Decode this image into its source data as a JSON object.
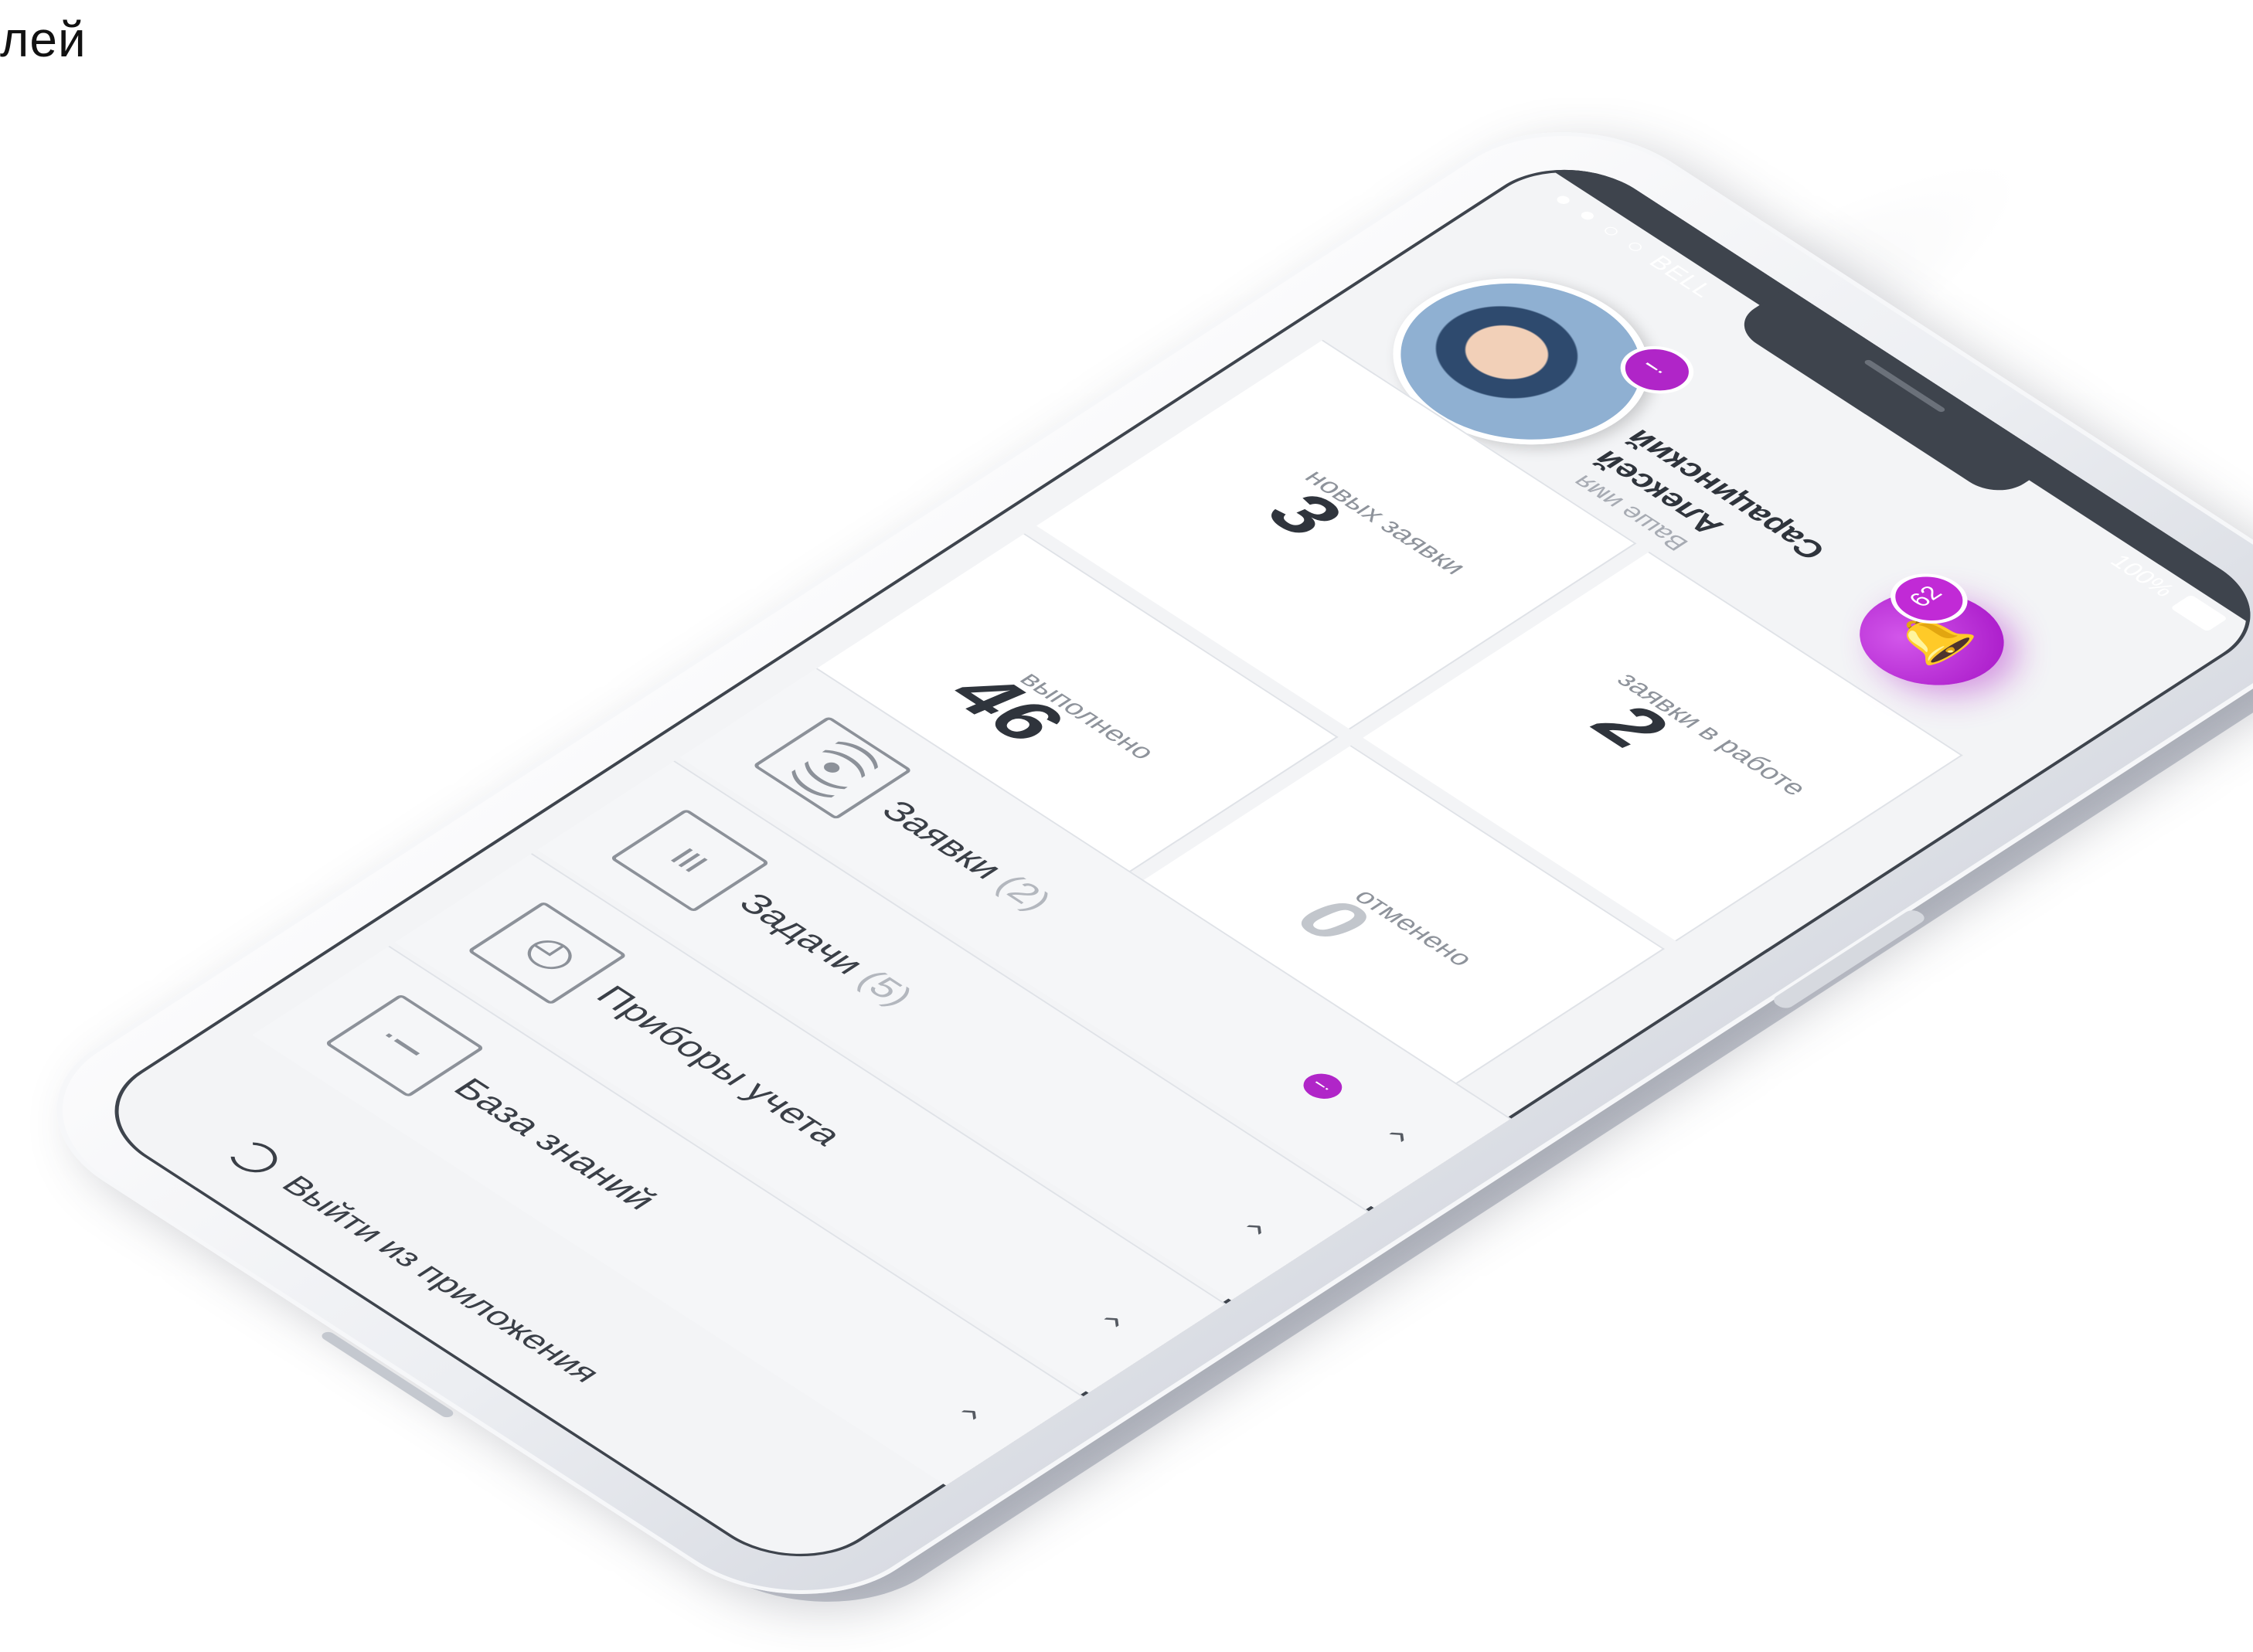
{
  "corner_text": "лей",
  "status": {
    "carrier": "●●○○ BELL",
    "battery": "100%"
  },
  "profile": {
    "name_label": "Ваше имя",
    "first_name": "Алексей",
    "last_name": "Сарацинский",
    "badge": "!"
  },
  "stats": [
    {
      "value": "3",
      "caption": "новых заявки"
    },
    {
      "value": "46",
      "caption": "выполнено"
    },
    {
      "value": "2",
      "caption": "заявки в работе"
    },
    {
      "value": "0",
      "caption": "отменено"
    }
  ],
  "menu": [
    {
      "label": "Заявки",
      "count": "(2)",
      "icon": "radio-signal-icon",
      "has_dot": true,
      "dot": "!"
    },
    {
      "label": "Задачи",
      "count": "(5)",
      "icon": "list-icon",
      "has_dot": false
    },
    {
      "label": "Приборы учета",
      "count": "",
      "icon": "meter-icon",
      "has_dot": false
    },
    {
      "label": "База знаний",
      "count": "",
      "icon": "info-icon",
      "has_dot": false
    }
  ],
  "logout_label": "Выйти из приложения",
  "notifications": {
    "count": "62",
    "icon": "bell-icon"
  },
  "colors": {
    "accent": "#b025c8",
    "dark_bar": "#3e444d",
    "screen_bg": "#f3f4f6"
  }
}
